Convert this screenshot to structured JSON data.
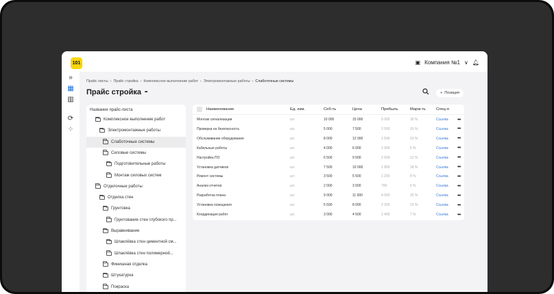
{
  "app": {
    "logo": "101",
    "company": "Компания №1",
    "icons": {
      "company": "building-icon",
      "chevron": "chevron-down-icon",
      "bell": "bell-icon"
    }
  },
  "sidebar": {
    "items": [
      {
        "icon": "chevrons-right-icon",
        "glyph": "»"
      },
      {
        "icon": "table-icon",
        "glyph": "▦"
      },
      {
        "icon": "bar-chart-icon",
        "glyph": "▥"
      },
      {
        "icon": "sync-icon",
        "glyph": "⟳"
      },
      {
        "icon": "apps-grid-icon",
        "glyph": "⁘"
      }
    ]
  },
  "breadcrumbs": [
    "Прайс листы",
    "Прайс стройка",
    "Комплексное выполнение работ",
    "Электромонтажные работы",
    "Слаботочные системы"
  ],
  "page": {
    "title": "Прайс стройка",
    "more": "•••",
    "add_button": "Позиция"
  },
  "tree": {
    "header": "Название прайс-листа",
    "items": [
      {
        "label": "Комплексное выполнение работ",
        "level": 1,
        "selected": false
      },
      {
        "label": "Электромонтажные работы",
        "level": 2,
        "selected": false
      },
      {
        "label": "Слаботочные системы",
        "level": 3,
        "selected": true
      },
      {
        "label": "Силовые системы",
        "level": 3,
        "selected": false
      },
      {
        "label": "Подготовительные работы",
        "level": 4,
        "selected": false
      },
      {
        "label": "Монтаж силовых систем",
        "level": 4,
        "selected": false
      },
      {
        "label": "Отделочные работы",
        "level": 1,
        "selected": false
      },
      {
        "label": "Отделка стен",
        "level": 2,
        "selected": false
      },
      {
        "label": "Грунтовка",
        "level": 3,
        "selected": false
      },
      {
        "label": "Грунтование стен глубокого пр...",
        "level": 4,
        "selected": false
      },
      {
        "label": "Выравнивание",
        "level": 3,
        "selected": false
      },
      {
        "label": "Шпаклёвка стен цементной см...",
        "level": 4,
        "selected": false
      },
      {
        "label": "Шпаклёвка стен полимерной...",
        "level": 4,
        "selected": false
      },
      {
        "label": "Финишная отделка",
        "level": 3,
        "selected": false
      },
      {
        "label": "Штукатурка",
        "level": 3,
        "selected": false
      },
      {
        "label": "Покраска",
        "level": 3,
        "selected": false
      }
    ]
  },
  "table": {
    "columns": [
      "Наименование",
      "Ед. изм.",
      "Себ-ть",
      "Цена",
      "Прибыль",
      "Марж-ть",
      "Спец-я"
    ],
    "rows": [
      [
        "Монтаж сигнализации",
        "шт.",
        "10 000",
        "15 000",
        "5 000",
        "30 %",
        "Ссылка"
      ],
      [
        "Проверка на безопасность",
        "шт.",
        "5 000",
        "7 500",
        "2 500",
        "15 %",
        "Ссылка"
      ],
      [
        "Обслуживание оборудования",
        "шт.",
        "8 000",
        "12 000",
        "1 500",
        "10 %",
        "Ссылка"
      ],
      [
        "Кабельные работы",
        "шт.",
        "4 000",
        "6 000",
        "1 000",
        "5 %",
        "Ссылка"
      ],
      [
        "Настройка ПО",
        "шт.",
        "6 500",
        "9 500",
        "2 500",
        "12 %",
        "Ссылка"
      ],
      [
        "Установка датчиков",
        "шт.",
        "7 500",
        "10 000",
        "1 800",
        "18 %",
        "Ссылка"
      ],
      [
        "Ремонт системы",
        "шт.",
        "3 500",
        "5 500",
        "1 200",
        "8 %",
        "Ссылка"
      ],
      [
        "Анализ отчетов",
        "шт.",
        "2 000",
        "3 000",
        "700",
        "6 %",
        "Ссылка"
      ],
      [
        "Разработка плана",
        "шт.",
        "9 000",
        "11 000",
        "4 000",
        "25 %",
        "Ссылка"
      ],
      [
        "Установка освещения",
        "шт.",
        "5 500",
        "8 000",
        "2 200",
        "15 %",
        "Ссылка"
      ],
      [
        "Координация работ",
        "шт.",
        "3 000",
        "4 500",
        "1 400",
        "7 %",
        "Ссылка"
      ]
    ],
    "row_menu": "•••"
  },
  "colors": {
    "accent": "#1f6fd6",
    "logo": "#f9d50f",
    "link": "#2f73d6",
    "muted": "#aaaaaa"
  }
}
